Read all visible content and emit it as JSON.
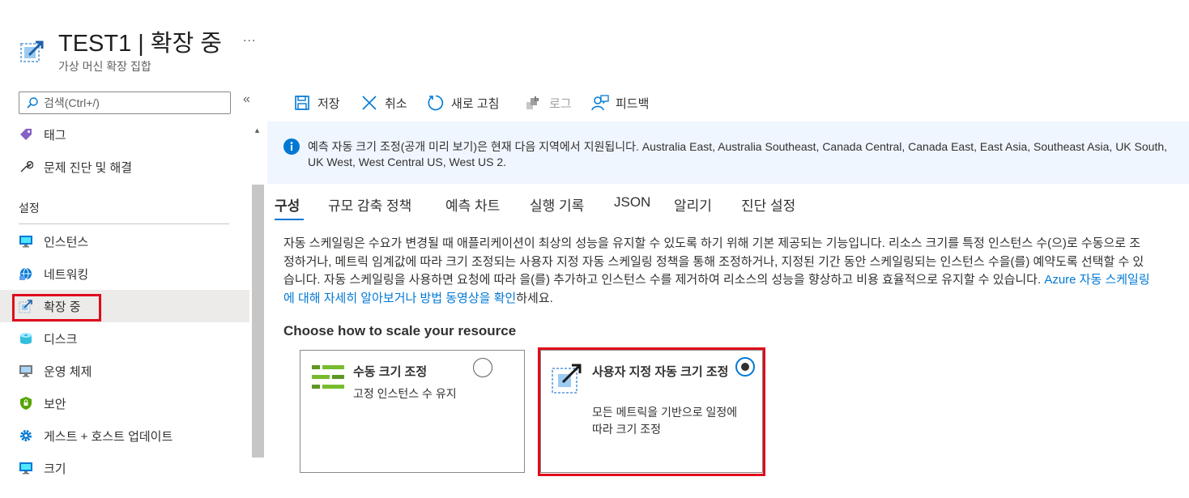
{
  "header": {
    "title": "TEST1 | 확장 중",
    "subtitle": "가상 머신 확장 집합",
    "more": "..."
  },
  "sidebar": {
    "search_placeholder": "검색(Ctrl+/)",
    "collapse": "«",
    "top_items": [
      {
        "label": "태그",
        "icon": "tag-icon"
      },
      {
        "label": "문제 진단 및 해결",
        "icon": "wrench-icon"
      }
    ],
    "section": "설정",
    "items": [
      {
        "label": "인스턴스",
        "icon": "monitor-icon"
      },
      {
        "label": "네트워킹",
        "icon": "network-icon"
      },
      {
        "label": "확장 중",
        "icon": "scale-icon",
        "active": true
      },
      {
        "label": "디스크",
        "icon": "disk-icon"
      },
      {
        "label": "운영 체제",
        "icon": "os-icon"
      },
      {
        "label": "보안",
        "icon": "shield-icon"
      },
      {
        "label": "게스트 + 호스트 업데이트",
        "icon": "gear-icon"
      },
      {
        "label": "크기",
        "icon": "size-icon"
      }
    ]
  },
  "toolbar": {
    "save": "저장",
    "cancel": "취소",
    "refresh": "새로 고침",
    "logs": "로그",
    "feedback": "피드백"
  },
  "banner": {
    "text": "예측 자동 크기 조정(공개 미리 보기)은 현재 다음 지역에서 지원됩니다. Australia East, Australia Southeast, Canada Central, Canada East, East Asia, Southeast Asia, UK South, UK West, West Central US, West US 2."
  },
  "tabs": [
    "구성",
    "규모 감축 정책",
    "예측 차트",
    "실행 기록",
    "JSON",
    "알리기",
    "진단 설정"
  ],
  "description": {
    "text": "자동 스케일링은 수요가 변경될 때 애플리케이션이 최상의 성능을 유지할 수 있도록 하기 위해 기본 제공되는 기능입니다. 리소스 크기를 특정 인스턴스 수(으)로 수동으로 조정하거나, 메트릭 임계값에 따라 크기 조정되는 사용자 지정 자동 스케일링 정책을 통해 조정하거나, 지정된 기간 동안 스케일링되는 인스턴스 수을(를) 예약도록 선택할 수 있습니다. 자동 스케일링을 사용하면 요청에 따라 을(를) 추가하고 인스턴스 수를 제거하여 리소스의 성능을 향상하고 비용 효율적으로 유지할 수 있습니다. ",
    "link": "Azure 자동 스케일링에 대해 자세히 알아보거나 방법 동영상을 확인",
    "suffix": "하세요."
  },
  "choose_heading": "Choose how to scale your resource",
  "options": [
    {
      "title": "수동 크기 조정",
      "subtitle": "고정 인스턴스 수 유지",
      "selected": false
    },
    {
      "title": "사용자 지정 자동 크기 조정",
      "subtitle": "모든 메트릭을 기반으로 일정에 따라 크기 조정",
      "selected": true
    }
  ]
}
